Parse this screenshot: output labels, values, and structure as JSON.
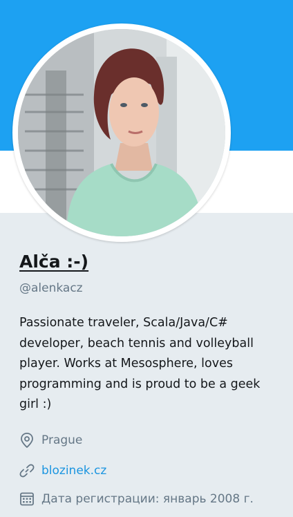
{
  "colors": {
    "banner": "#1da1f2",
    "background": "#e6ecf0",
    "muted_text": "#657786",
    "link": "#1b95e0"
  },
  "profile": {
    "display_name": "Alča :-)",
    "handle": "@alenkacz",
    "bio": "Passionate traveler, Scala/Java/C# developer, beach tennis and volleyball player. Works at Mesosphere, loves programming and is proud to be a geek girl :)",
    "location": "Prague",
    "website": "blozinek.cz",
    "joined": "Дата регистрации: январь 2008 г."
  },
  "icons": {
    "location": "map-pin-icon",
    "website": "link-icon",
    "joined": "calendar-icon"
  }
}
